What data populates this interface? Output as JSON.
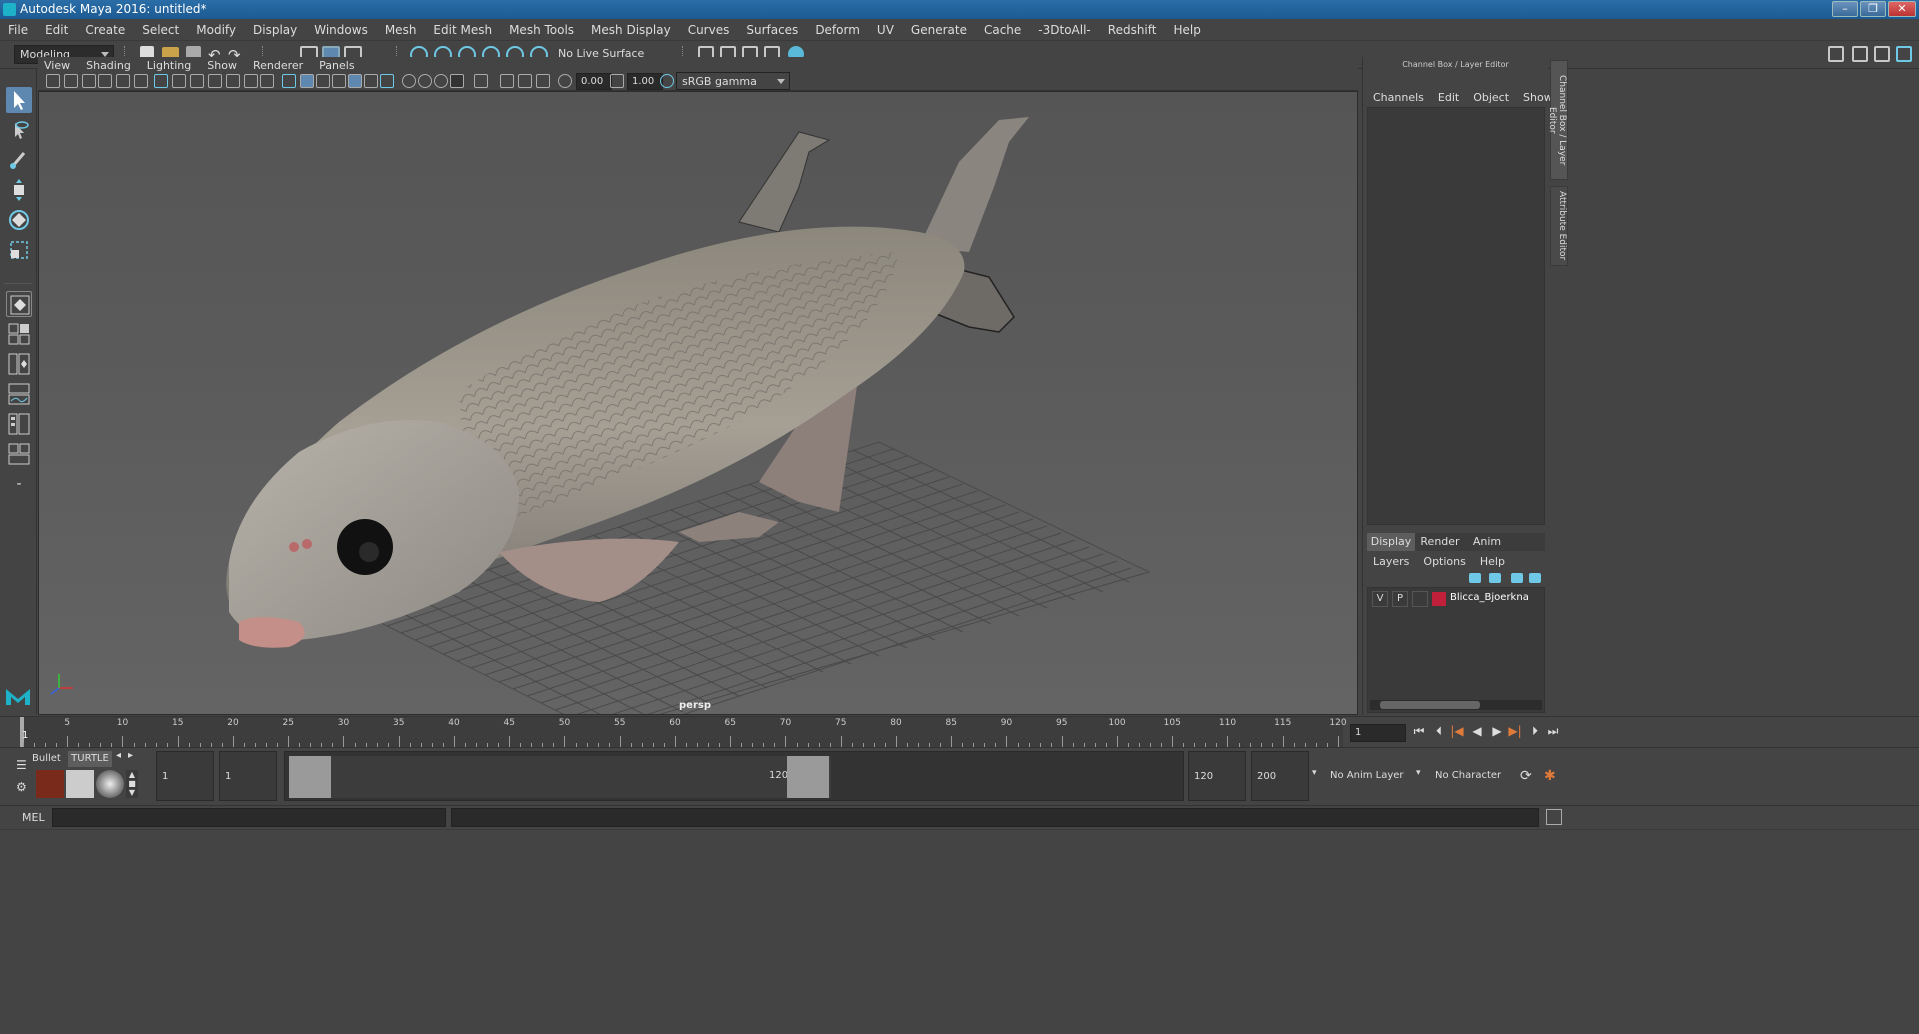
{
  "window": {
    "title": "Autodesk Maya 2016: untitled*",
    "minimize": "–",
    "maximize": "❐",
    "close": "✕"
  },
  "menubar": [
    "File",
    "Edit",
    "Create",
    "Select",
    "Modify",
    "Display",
    "Windows",
    "Mesh",
    "Edit Mesh",
    "Mesh Tools",
    "Mesh Display",
    "Curves",
    "Surfaces",
    "Deform",
    "UV",
    "Generate",
    "Cache",
    "-3DtoAll-",
    "Redshift",
    "Help"
  ],
  "statusline": {
    "mode": "Modeling",
    "live_surface": "No Live Surface"
  },
  "viewport": {
    "menu": [
      "View",
      "Shading",
      "Lighting",
      "Show",
      "Renderer",
      "Panels"
    ],
    "exposure": "0.00",
    "gamma": "1.00",
    "color_space": "sRGB gamma",
    "camera": "persp"
  },
  "channel_box": {
    "title": "Channel Box / Layer Editor",
    "menu": [
      "Channels",
      "Edit",
      "Object",
      "Show"
    ],
    "side_tabs": [
      "Channel Box / Layer Editor",
      "Attribute Editor"
    ]
  },
  "layer_editor": {
    "tabs": [
      "Display",
      "Render",
      "Anim"
    ],
    "active_tab": "Display",
    "menu": [
      "Layers",
      "Options",
      "Help"
    ],
    "layers": [
      {
        "visible": "V",
        "playback": "P",
        "color": "#c0203a",
        "name": "Blicca_Bjoerkna"
      }
    ]
  },
  "timeline": {
    "ticks": [
      "5",
      "10",
      "15",
      "20",
      "25",
      "30",
      "35",
      "40",
      "45",
      "50",
      "55",
      "60",
      "65",
      "70",
      "75",
      "80",
      "85",
      "90",
      "95",
      "100",
      "105",
      "110",
      "115",
      "120"
    ],
    "current_marker": "1",
    "current_frame": "1"
  },
  "shelf": {
    "tabs": [
      "Bullet",
      "TURTLE"
    ]
  },
  "range": {
    "start": "1",
    "anim_start": "1",
    "range_start_label": "1",
    "range_end_label": "120",
    "end": "120",
    "anim_end": "200",
    "anim_layer": "No Anim Layer",
    "character_set": "No Character Set"
  },
  "command_line": {
    "language": "MEL"
  },
  "colors": {
    "accent": "#5e88b0",
    "layer_red": "#c0203a",
    "title_blue": "#1c5a93"
  }
}
